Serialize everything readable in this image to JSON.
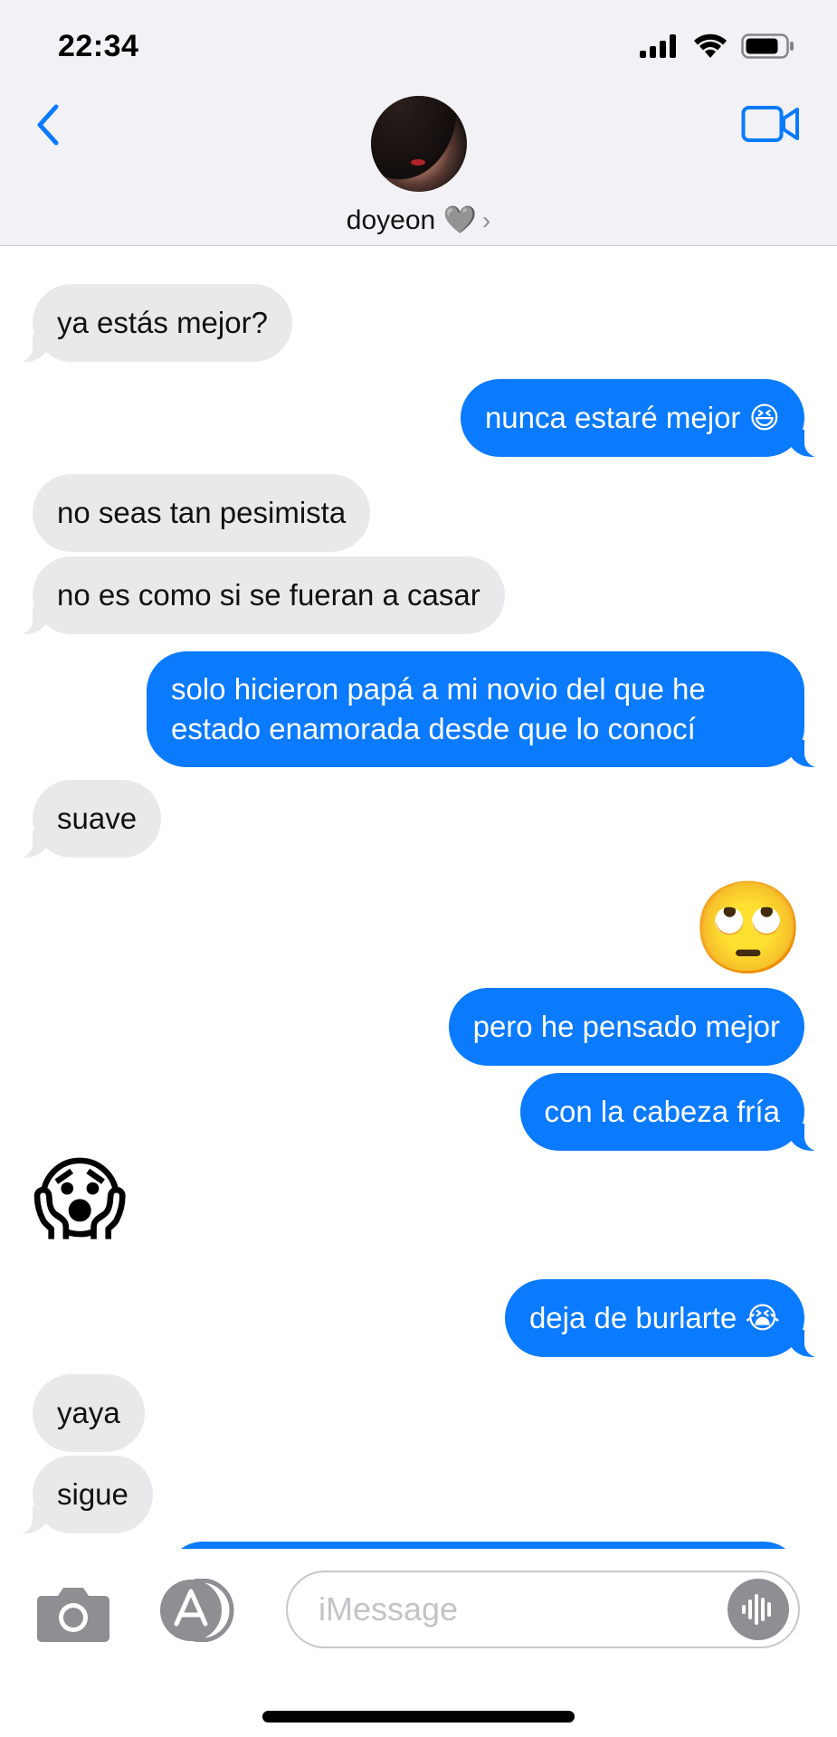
{
  "status": {
    "time": "22:34"
  },
  "header": {
    "contact_name": "doyeon 🩶",
    "chevron": "›"
  },
  "messages": [
    {
      "side": "in",
      "text": "ya estás mejor?"
    },
    {
      "side": "out",
      "text": "nunca estaré mejor 😆"
    },
    {
      "side": "in",
      "text": "no seas tan pesimista"
    },
    {
      "side": "in",
      "text": "no es como si se fueran a casar"
    },
    {
      "side": "out",
      "text": "solo hicieron papá a mi novio del que he estado enamorada desde que lo conocí"
    },
    {
      "side": "in",
      "text": "suave"
    },
    {
      "side": "out",
      "emoji": "🙄"
    },
    {
      "side": "out",
      "text": "pero he pensado mejor"
    },
    {
      "side": "out",
      "text": "con la cabeza fría"
    },
    {
      "side": "in",
      "emoji": "😱"
    },
    {
      "side": "out",
      "text": "deja de burlarte 😭"
    },
    {
      "side": "in",
      "text": "yaya"
    },
    {
      "side": "in",
      "text": "sigue"
    }
  ],
  "composer": {
    "placeholder": "iMessage"
  },
  "icons": {
    "back": "chevron-left-icon",
    "video": "video-camera-icon",
    "camera": "camera-icon",
    "apps": "app-store-icon",
    "audio": "audio-waveform-icon"
  },
  "colors": {
    "outgoing_bubble": "#0a7aff",
    "incoming_bubble": "#e9e9eb",
    "accent": "#0a7aff"
  }
}
